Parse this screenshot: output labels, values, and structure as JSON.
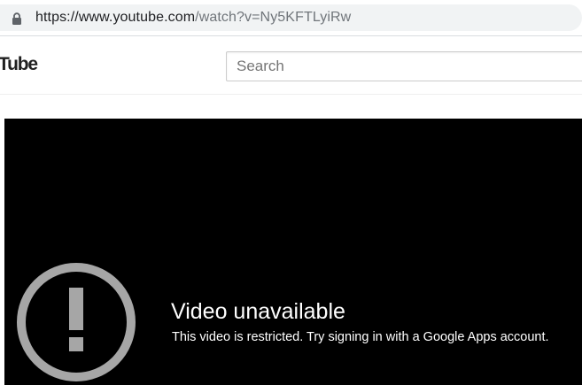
{
  "browser": {
    "url_host": "https://www.youtube.com",
    "url_path": "/watch?v=Ny5KFTLyiRw",
    "lock_icon": "lock-icon"
  },
  "masthead": {
    "logo_text": "Tube",
    "search_placeholder": "Search"
  },
  "player": {
    "error_icon": "exclamation-circle-icon",
    "error_title": "Video unavailable",
    "error_message": "This video is restricted. Try signing in with a Google Apps account."
  },
  "colors": {
    "player_background": "#000000",
    "icon_gray": "#a6a6a6",
    "text_white": "#ffffff"
  }
}
